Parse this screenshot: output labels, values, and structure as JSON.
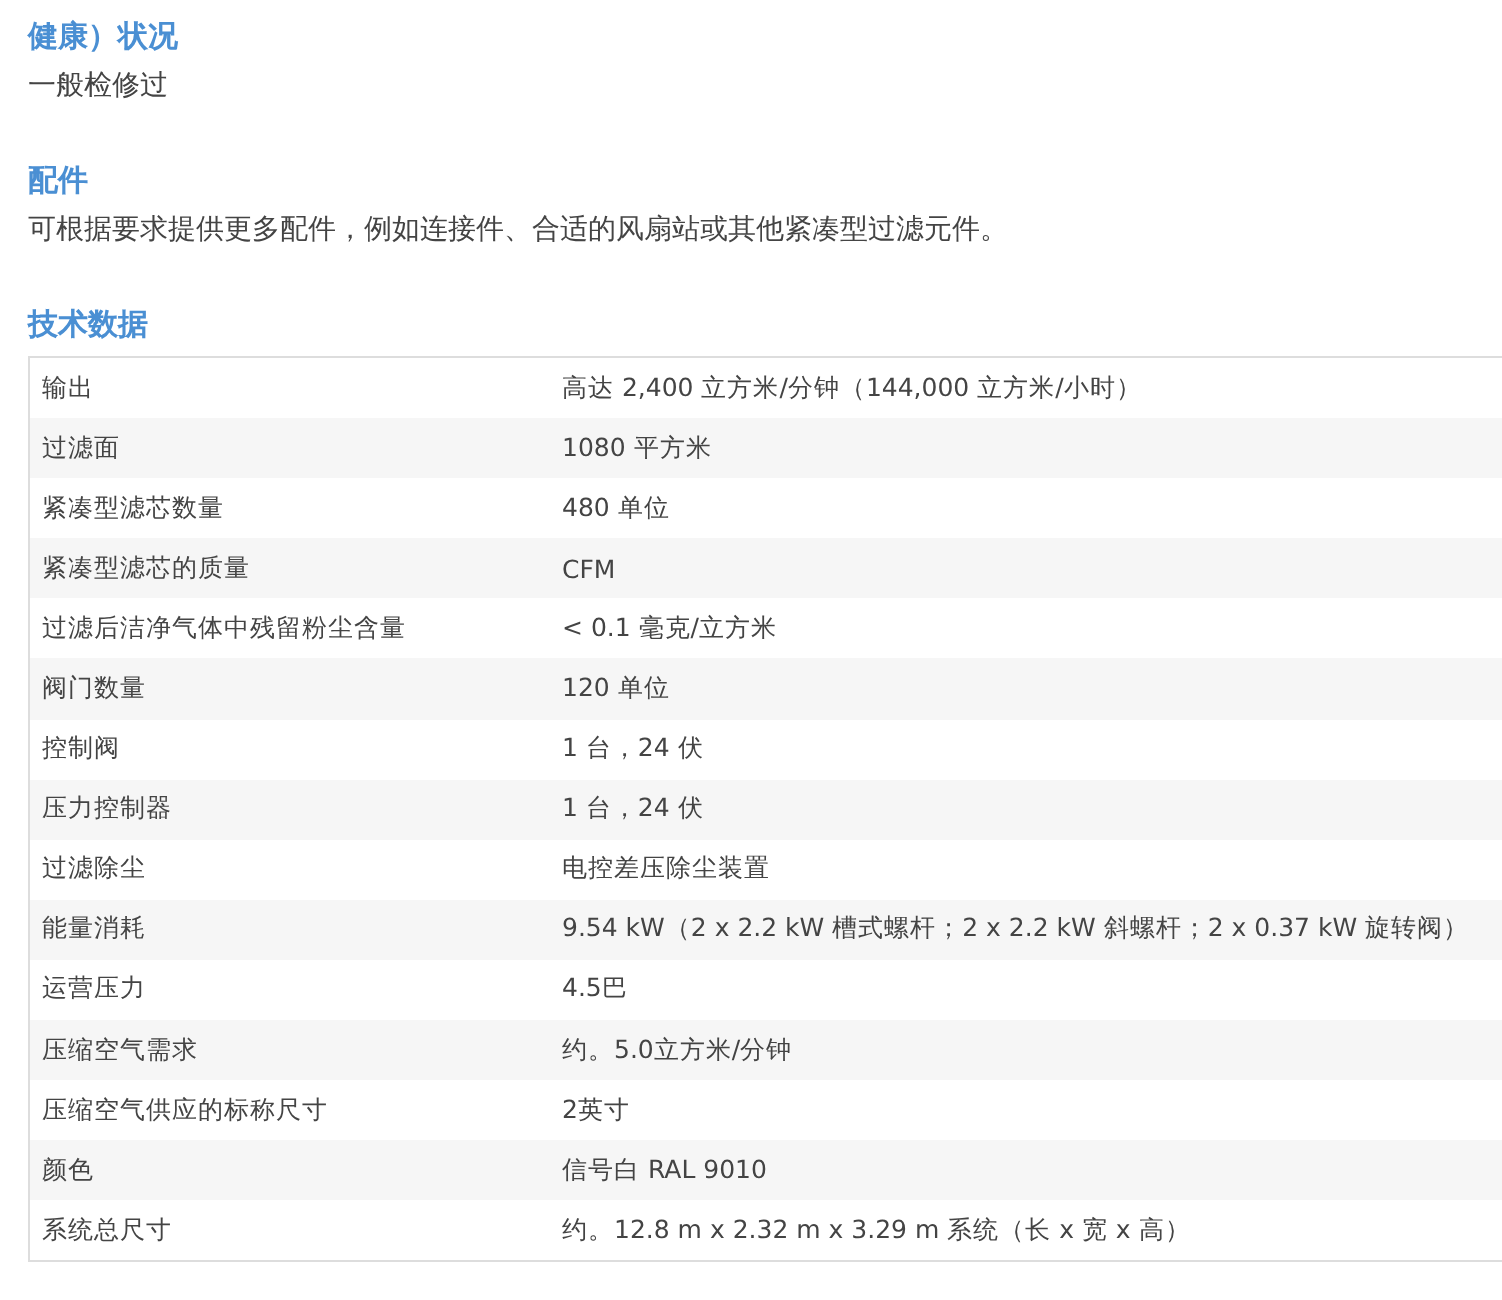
{
  "sections": [
    {
      "heading": "健康）状况",
      "text": "一般检修过"
    },
    {
      "heading": "配件",
      "text": "可根据要求提供更多配件，例如连接件、合适的风扇站或其他紧凑型过滤元件。"
    }
  ],
  "table": {
    "heading": "技术数据",
    "rows": [
      {
        "label": "输出",
        "value": "高达 2,400 立方米/分钟（144,000 立方米/小时）"
      },
      {
        "label": "过滤面",
        "value": "1080 平方米"
      },
      {
        "label": "紧凑型滤芯数量",
        "value": "480 单位"
      },
      {
        "label": "紧凑型滤芯的质量",
        "value": "CFM"
      },
      {
        "label": "过滤后洁净气体中残留粉尘含量",
        "value": "< 0.1 毫克/立方米"
      },
      {
        "label": "阀门数量",
        "value": "120 单位"
      },
      {
        "label": "控制阀",
        "value": "1 台，24 伏"
      },
      {
        "label": "压力控制器",
        "value": "1 台，24 伏"
      },
      {
        "label": "过滤除尘",
        "value": "电控差压除尘装置"
      },
      {
        "label": "能量消耗",
        "value": "9.54 kW（2 x 2.2 kW 槽式螺杆；2 x 2.2 kW 斜螺杆；2 x 0.37 kW 旋转阀）"
      },
      {
        "label": "运营压力",
        "value": "4.5巴"
      },
      {
        "label": "压缩空气需求",
        "value": "约。5.0立方米/分钟"
      },
      {
        "label": "压缩空气供应的标称尺寸",
        "value": "2英寸"
      },
      {
        "label": "颜色",
        "value": "信号白 RAL 9010"
      },
      {
        "label": "系统总尺寸",
        "value": "约。12.8 m x 2.32 m x 3.29 m 系统（长 x 宽 x 高）"
      }
    ]
  }
}
